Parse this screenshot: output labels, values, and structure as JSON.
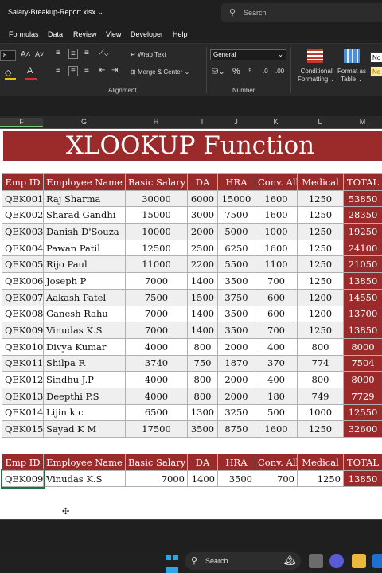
{
  "window": {
    "file_name": "Salary-Breakup-Report.xlsx",
    "search_placeholder": "Search"
  },
  "menu": [
    "Formulas",
    "Data",
    "Review",
    "View",
    "Developer",
    "Help"
  ],
  "ribbon": {
    "font_size": "8",
    "wrap_text": "Wrap Text",
    "merge_center": "Merge & Center",
    "alignment_label": "Alignment",
    "number_format": "General",
    "number_label": "Number",
    "conditional_formatting": [
      "Conditional",
      "Formatting"
    ],
    "format_as_table": [
      "Format as",
      "Table"
    ],
    "style_normal": "No",
    "style_neutral": "Ne"
  },
  "columns": [
    "F",
    "G",
    "H",
    "I",
    "J",
    "K",
    "L",
    "M"
  ],
  "sheet": {
    "title": "XLOOKUP Function",
    "headers": [
      "Emp ID",
      "Employee Name",
      "Basic Salary",
      "DA",
      "HRA",
      "Conv. All",
      "Medical",
      "TOTAL"
    ],
    "rows": [
      [
        "QEK001",
        "Raj Sharma",
        "30000",
        "6000",
        "15000",
        "1600",
        "1250",
        "53850"
      ],
      [
        "QEK002",
        "Sharad Gandhi",
        "15000",
        "3000",
        "7500",
        "1600",
        "1250",
        "28350"
      ],
      [
        "QEK003",
        "Danish D'Souza",
        "10000",
        "2000",
        "5000",
        "1000",
        "1250",
        "19250"
      ],
      [
        "QEK004",
        "Pawan Patil",
        "12500",
        "2500",
        "6250",
        "1600",
        "1250",
        "24100"
      ],
      [
        "QEK005",
        "Rijo Paul",
        "11000",
        "2200",
        "5500",
        "1100",
        "1250",
        "21050"
      ],
      [
        "QEK006",
        "Joseph P",
        "7000",
        "1400",
        "3500",
        "700",
        "1250",
        "13850"
      ],
      [
        "QEK007",
        "Aakash Patel",
        "7500",
        "1500",
        "3750",
        "600",
        "1200",
        "14550"
      ],
      [
        "QEK008",
        "Ganesh Rahu",
        "7000",
        "1400",
        "3500",
        "600",
        "1200",
        "13700"
      ],
      [
        "QEK009",
        "Vinudas K.S",
        "7000",
        "1400",
        "3500",
        "700",
        "1250",
        "13850"
      ],
      [
        "QEK010",
        "Divya Kumar",
        "4000",
        "800",
        "2000",
        "400",
        "800",
        "8000"
      ],
      [
        "QEK011",
        "Shilpa R",
        "3740",
        "750",
        "1870",
        "370",
        "774",
        "7504"
      ],
      [
        "QEK012",
        "Sindhu J.P",
        "4000",
        "800",
        "2000",
        "400",
        "800",
        "8000"
      ],
      [
        "QEK013",
        "Deepthi P.S",
        "4000",
        "800",
        "2000",
        "180",
        "749",
        "7729"
      ],
      [
        "QEK014",
        "Lijin k c",
        "6500",
        "1300",
        "3250",
        "500",
        "1000",
        "12550"
      ],
      [
        "QEK015",
        "Sayad K M",
        "17500",
        "3500",
        "8750",
        "1600",
        "1250",
        "32600"
      ]
    ],
    "lookup": [
      "QEK009",
      "Vinudas K.S",
      "7000",
      "1400",
      "3500",
      "700",
      "1250",
      "13850"
    ]
  },
  "taskbar": {
    "search_label": "Search"
  },
  "colors": {
    "header_red": "#9b2a2b",
    "excel_green": "#217346"
  }
}
